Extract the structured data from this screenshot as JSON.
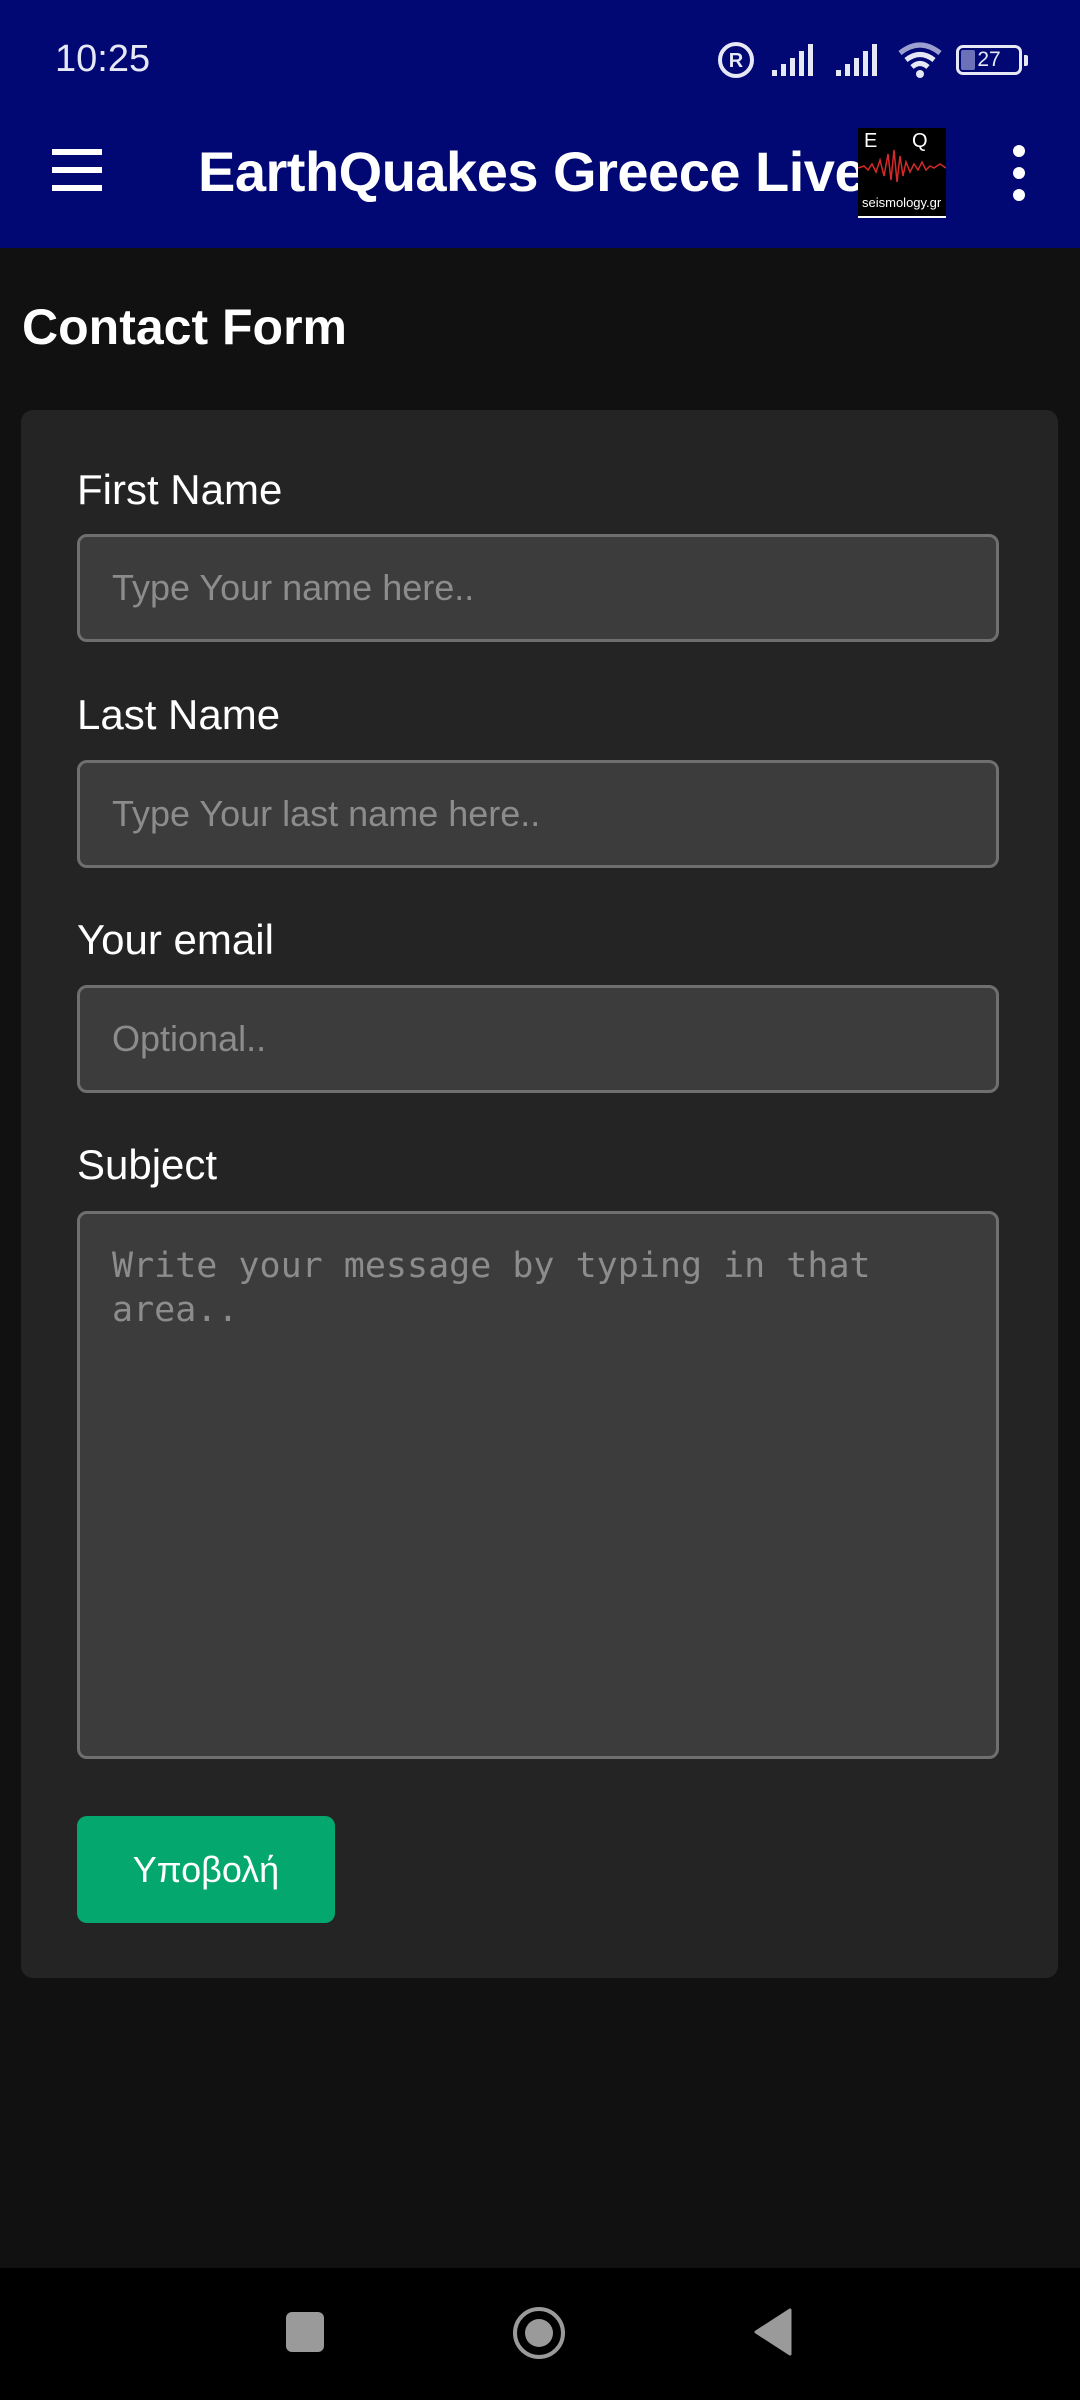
{
  "status_bar": {
    "time": "10:25",
    "battery_level": "27",
    "icons": [
      "registered-icon",
      "signal-icon",
      "signal-icon",
      "wifi-icon",
      "battery-icon"
    ]
  },
  "app_bar": {
    "title": "EarthQuakes Greece Live",
    "logo": {
      "letter_left": "E",
      "letter_right": "Q",
      "caption": "seismology.gr"
    },
    "menu_icon": "hamburger-icon",
    "more_icon": "more-vertical-icon"
  },
  "page": {
    "title": "Contact Form"
  },
  "form": {
    "first_name": {
      "label": "First Name",
      "value": "",
      "placeholder": "Type Your name here.."
    },
    "last_name": {
      "label": "Last Name",
      "value": "",
      "placeholder": "Type Your last name here.."
    },
    "email": {
      "label": "Your email",
      "value": "",
      "placeholder": "Optional.."
    },
    "subject": {
      "label": "Subject",
      "value": "",
      "placeholder": "Write your message by typing in that area.."
    },
    "submit_label": "Υποβολή"
  },
  "colors": {
    "app_bar": "#020873",
    "background": "#111111",
    "card": "#242424",
    "input": "#3c3c3c",
    "submit": "#04a86f"
  },
  "nav_bar": {
    "items": [
      "recents-icon",
      "home-icon",
      "back-icon"
    ]
  }
}
